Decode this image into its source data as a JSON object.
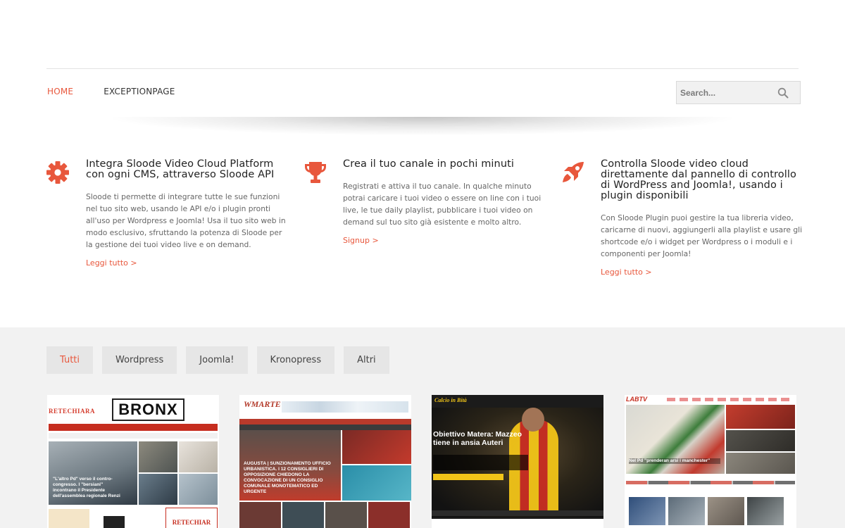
{
  "nav": {
    "items": [
      {
        "label": "HOME",
        "active": true
      },
      {
        "label": "EXCEPTIONPAGE",
        "active": false
      }
    ]
  },
  "search": {
    "placeholder": "Search...",
    "icon": "search-icon"
  },
  "features": [
    {
      "icon": "gear-icon",
      "title": "Integra Sloode Video Cloud Platform con ogni CMS, attraverso Sloode API",
      "text": "Sloode ti permette di integrare tutte le sue funzioni nel tuo sito web, usando le API e/o i plugin pronti all'uso per Wordpress e Joomla! Usa il tuo sito web in modo esclusivo, sfruttando la potenza di Sloode per la gestione dei tuoi video live e on demand.",
      "link": "Leggi tutto >"
    },
    {
      "icon": "trophy-icon",
      "title": "Crea il tuo canale in pochi minuti",
      "text": "Registrati e attiva il tuo canale. In qualche minuto potrai caricare i tuoi video o essere on line con i tuoi live, le tue daily playlist, pubblicare i tuoi video on demand sul tuo sito già esistente e molto altro.",
      "link": "Signup >"
    },
    {
      "icon": "rocket-icon",
      "title": "Controlla Sloode video cloud direttamente dal pannello di controllo di WordPress and Joomla!, usando i plugin disponibili",
      "text": "Con Sloode Plugin puoi gestire la tua libreria video, caricarne di nuovi, aggiungerli alla playlist e usare gli shortcode e/o i widget per Wordpress o i moduli e i componenti per Joomla!",
      "link": "Leggi tutto >"
    }
  ],
  "filters": [
    {
      "label": "Tutti",
      "active": true
    },
    {
      "label": "Wordpress",
      "active": false
    },
    {
      "label": "Joomla!",
      "active": false
    },
    {
      "label": "Kronopress",
      "active": false
    },
    {
      "label": "Altri",
      "active": false
    }
  ],
  "thumbnails": {
    "t1": {
      "logo": "RETECHIARA",
      "brand": "BRONX",
      "headline": "\"L'altro Pd\" verso il contro-congresso. I \"bersiani\" incontrano il Presidente dell'assemblea regionale Renzi",
      "banner": "RETECHIAR"
    },
    "t2": {
      "logo": "WMARTE",
      "headline": "AUGUSTA | SUNZIONAMENTO UFFICIO URBANISTICA. I 12 CONSIGLIERI DI OPPOSIZIONE CHIEDONO LA CONVOCAZIONE DI UN CONSIGLIO COMUNALE MONOTEMATICO ED URGENTE"
    },
    "t3": {
      "brand": "Calcio in Bità",
      "headline": "Obiettivo Matera: Mazzeo tiene in ansia Auteri"
    },
    "t4": {
      "logo": "LABTV",
      "headline": "Nel Pd \"prenderan arsi i manchester\""
    }
  },
  "colors": {
    "accent": "#e8573c",
    "portfolio_bg": "#f2f2f2",
    "chip_bg": "#e6e6e6"
  }
}
